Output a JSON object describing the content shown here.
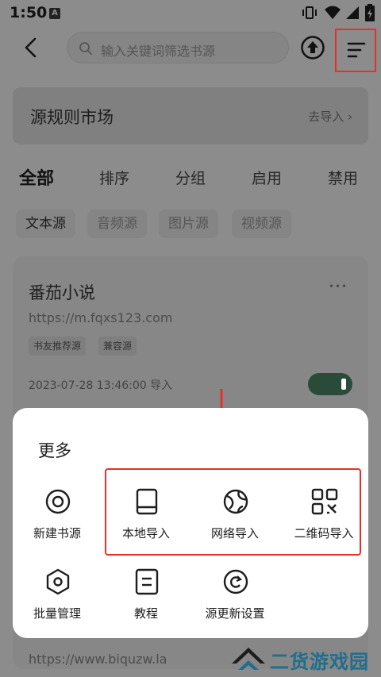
{
  "status_bar": {
    "time": "1:50",
    "notif_icon": "A"
  },
  "toolbar": {
    "search_placeholder": "输入关键词筛选书源"
  },
  "market": {
    "title": "源规则市场",
    "link": "去导入 ›"
  },
  "filter_tabs": [
    "全部",
    "排序",
    "分组",
    "启用",
    "禁用"
  ],
  "type_chips": [
    "文本源",
    "音频源",
    "图片源",
    "视频源"
  ],
  "card": {
    "title": "番茄小说",
    "more": "···",
    "url": "https://m.fqxs123.com",
    "tags": [
      "书友推荐源",
      "兼容源"
    ],
    "time": "2023-07-28 13:46:00 导入",
    "enabled": true
  },
  "card2": {
    "url_partial": "https://www.biquzw.la"
  },
  "sheet": {
    "title": "更多",
    "actions": [
      {
        "label": "新建书源",
        "icon": "target-icon"
      },
      {
        "label": "本地导入",
        "icon": "book-icon"
      },
      {
        "label": "网络导入",
        "icon": "globe-icon"
      },
      {
        "label": "二维码导入",
        "icon": "qr-code-icon"
      },
      {
        "label": "批量管理",
        "icon": "hexagon-icon"
      },
      {
        "label": "教程",
        "icon": "document-icon"
      },
      {
        "label": "源更新设置",
        "icon": "refresh-icon"
      }
    ]
  },
  "watermark": {
    "text": "二货游戏园"
  },
  "colors": {
    "accent": "#e8302a",
    "toggle": "#2a4a3a",
    "watermark": "#1f6e8e"
  }
}
